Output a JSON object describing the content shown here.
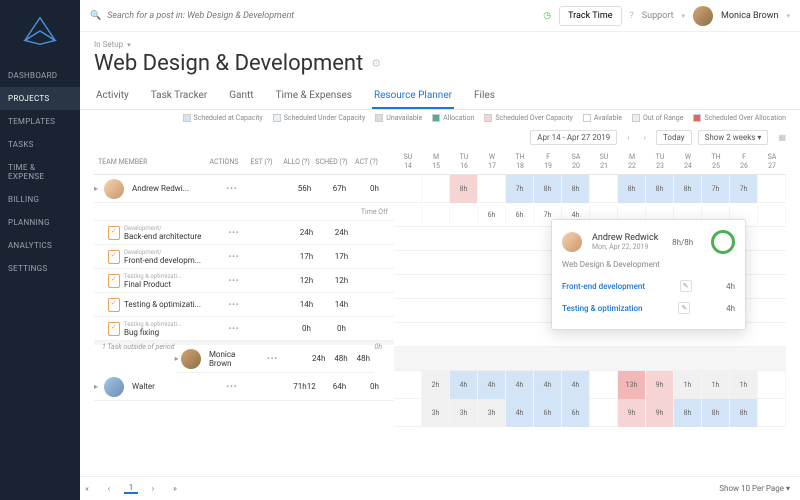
{
  "search_placeholder": "Search for a post in: Web Design & Development",
  "top": {
    "track": "Track Time",
    "support": "Support",
    "user": "Monica Brown"
  },
  "header": {
    "setup": "In Setup",
    "title": "Web Design & Development"
  },
  "nav": [
    "DASHBOARD",
    "PROJECTS",
    "TEMPLATES",
    "TASKS",
    "TIME & EXPENSE",
    "BILLING",
    "PLANNING",
    "ANALYTICS",
    "SETTINGS"
  ],
  "tabs": [
    "Activity",
    "Task Tracker",
    "Gantt",
    "Time & Expenses",
    "Resource Planner",
    "Files"
  ],
  "active_tab": 4,
  "legend": [
    "Scheduled at Capacity",
    "Scheduled Under Capacity",
    "Unavailable",
    "Allocation",
    "Scheduled Over Capacity",
    "Available",
    "Out of Range",
    "Scheduled Over Allocation"
  ],
  "toolbar": {
    "range": "Apr 14 - Apr 27 2019",
    "today": "Today",
    "show": "Show 2 weeks"
  },
  "cols": {
    "name": "TEAM MEMBER",
    "actions": "ACTIONS",
    "est": "EST (?)",
    "allo": "ALLO (?)",
    "sched": "SCHED (?)",
    "act": "ACT (?)"
  },
  "days": [
    {
      "d": "SU",
      "n": "14"
    },
    {
      "d": "M",
      "n": "15"
    },
    {
      "d": "TU",
      "n": "16"
    },
    {
      "d": "W",
      "n": "17"
    },
    {
      "d": "TH",
      "n": "18"
    },
    {
      "d": "F",
      "n": "19"
    },
    {
      "d": "SA",
      "n": "20"
    },
    {
      "d": "SU",
      "n": "21"
    },
    {
      "d": "M",
      "n": "22"
    },
    {
      "d": "TU",
      "n": "23"
    },
    {
      "d": "W",
      "n": "24"
    },
    {
      "d": "TH",
      "n": "25"
    },
    {
      "d": "F",
      "n": "26"
    },
    {
      "d": "SA",
      "n": "27"
    }
  ],
  "people": [
    {
      "name": "Andrew Redwi...",
      "est": "",
      "allo": "56h",
      "sched": "67h",
      "act": "0h",
      "cells": [
        "",
        "",
        "8h",
        "",
        "7h",
        "8h",
        "8h",
        "",
        "8h",
        "8h",
        "8h",
        "7h",
        "7h",
        ""
      ],
      "cls": [
        "",
        "",
        "c-red",
        "",
        "c-blue",
        "c-blue",
        "c-blue",
        "",
        "c-blue",
        "c-blue",
        "c-blue",
        "c-blue",
        "c-blue",
        ""
      ],
      "timeoff": "Time Off",
      "tcells": [
        "",
        "",
        "",
        "6h",
        "6h",
        "7h",
        "4h",
        "",
        "",
        "",
        "",
        "",
        "",
        ""
      ],
      "tasks": [
        {
          "cat": "Development/",
          "name": "Back-end architecture",
          "allo": "24h",
          "sched": "24h"
        },
        {
          "cat": "Development/",
          "name": "Front-end developm...",
          "allo": "17h",
          "sched": "17h"
        },
        {
          "cat": "Testing & optimizati...",
          "name": "Final Product",
          "allo": "12h",
          "sched": "12h"
        },
        {
          "cat": "",
          "name": "Testing & optimizati...",
          "allo": "14h",
          "sched": "14h"
        },
        {
          "cat": "Testing & optimizati...",
          "name": "Bug fixing",
          "allo": "0h",
          "sched": "0h"
        }
      ],
      "outside": "1 Task outside of period",
      "outside_v": "0h"
    },
    {
      "name": "Monica Brown",
      "est": "",
      "allo": "24h",
      "sched": "48h",
      "act": "48h",
      "cells": [
        "",
        "2h",
        "4h",
        "4h",
        "4h",
        "4h",
        "4h",
        "",
        "13h",
        "9h",
        "1h",
        "1h",
        "1h",
        ""
      ],
      "cls": [
        "",
        "c-gray",
        "c-blue",
        "c-blue",
        "c-blue",
        "c-blue",
        "c-blue",
        "",
        "c-red2",
        "c-red",
        "c-gray",
        "c-gray",
        "c-gray",
        ""
      ]
    },
    {
      "name": "Walter",
      "est": "",
      "allo": "71h12",
      "sched": "64h",
      "act": "0h",
      "cells": [
        "",
        "3h",
        "3h",
        "3h",
        "4h",
        "6h",
        "6h",
        "",
        "9h",
        "9h",
        "8h",
        "8h",
        "8h",
        ""
      ],
      "cls": [
        "",
        "c-gray",
        "c-gray",
        "c-gray",
        "c-blue",
        "c-blue",
        "c-blue",
        "",
        "c-red",
        "c-red",
        "c-blue",
        "c-blue",
        "c-blue",
        ""
      ]
    }
  ],
  "popover": {
    "name": "Andrew Redwick",
    "date": "Mon, Apr 22, 2019",
    "hours": "8h/8h",
    "project": "Web Design & Development",
    "tasks": [
      {
        "name": "Front-end development",
        "h": "4h"
      },
      {
        "name": "Testing & optimization",
        "h": "4h"
      }
    ]
  },
  "pager": {
    "page": "1",
    "show": "Show 10 Per Page"
  }
}
